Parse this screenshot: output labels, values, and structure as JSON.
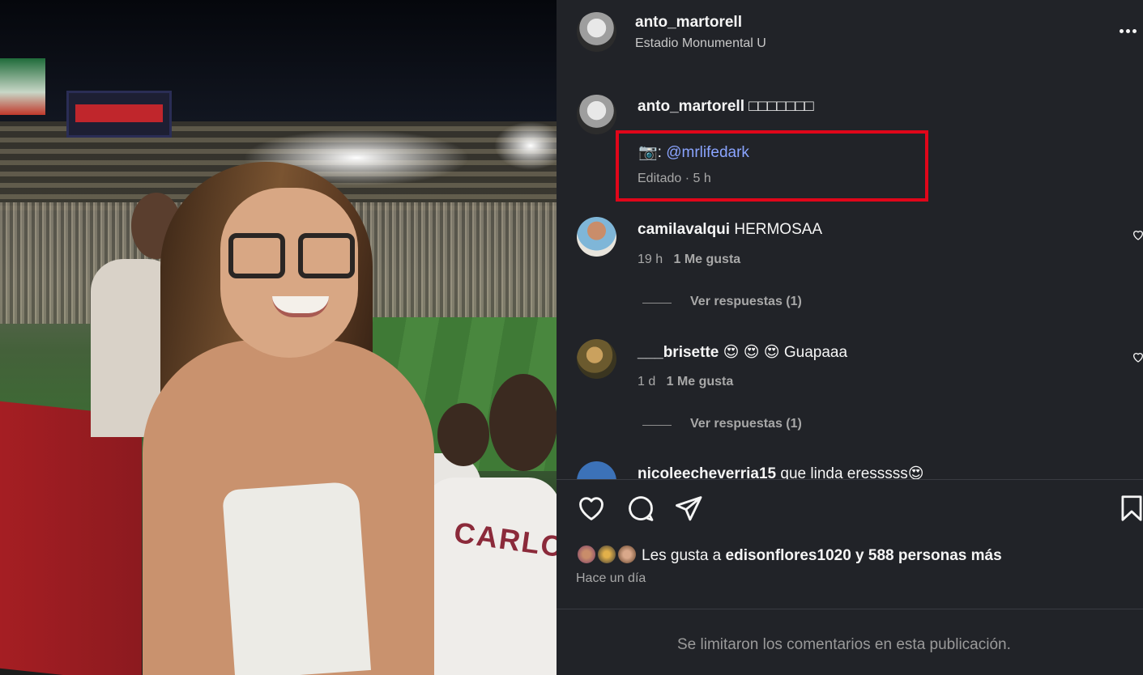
{
  "post": {
    "author": "anto_martorell",
    "location": "Estadio Monumental U"
  },
  "caption": {
    "author": "anto_martorell",
    "text": "□□□□□□□",
    "camera_glyph": "📷",
    "separator": ":",
    "mention": "@mrlifedark",
    "meta": "Editado · 5 h"
  },
  "comments": [
    {
      "user": "camilavalqui",
      "text": "HERMOSAA",
      "time": "19 h",
      "likes": "1 Me gusta",
      "replies": "Ver respuestas (1)"
    },
    {
      "user": "___brisette",
      "text": "😍 😍 😍 Guapaaa",
      "time": "1 d",
      "likes": "1 Me gusta",
      "replies": "Ver respuestas (1)"
    },
    {
      "user": "nicoleecheverria15",
      "text": "que linda eresssss😍"
    }
  ],
  "likes": {
    "prefix": "Les gusta a ",
    "user": "edisonflores1020",
    "suffix": " y 588 personas más"
  },
  "timestamp": "Hace un día",
  "comments_limited": "Se limitaron los comentarios en esta publicación.",
  "photo": {
    "jersey_text": "CARLOS"
  },
  "colors": {
    "panel_bg": "#212328",
    "mention": "#8aa4ff",
    "highlight_box": "#e0061a"
  },
  "icons": [
    "heart-icon",
    "comment-icon",
    "share-icon",
    "bookmark-icon",
    "more-options-icon"
  ]
}
